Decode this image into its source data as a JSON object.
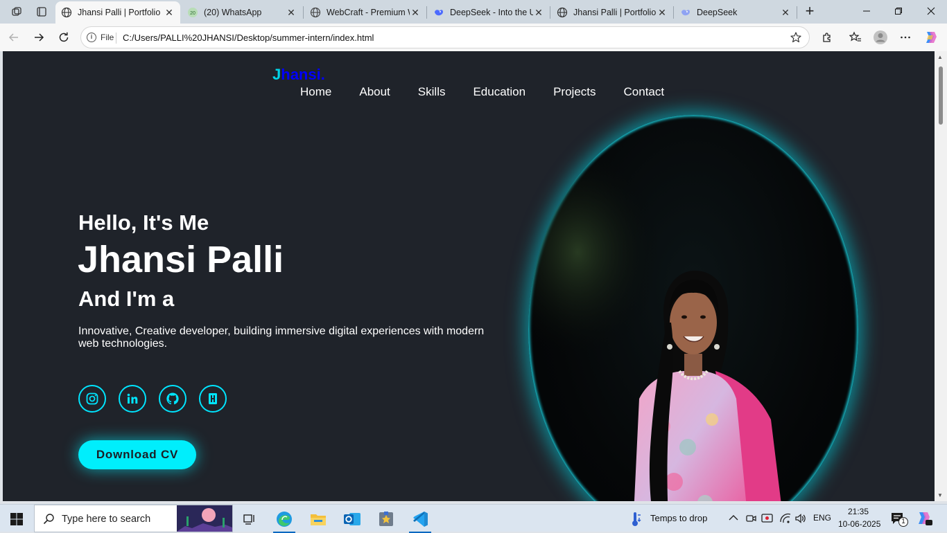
{
  "browser": {
    "tabs": [
      {
        "title": "Jhansi Palli | Portfolio",
        "icon": "globe-icon",
        "active": true
      },
      {
        "title": "(20) WhatsApp",
        "icon": "whatsapp-icon",
        "badge": "20",
        "active": false
      },
      {
        "title": "WebCraft - Premium W",
        "icon": "globe-icon",
        "active": false
      },
      {
        "title": "DeepSeek - Into the U",
        "icon": "deepseek-icon",
        "active": false
      },
      {
        "title": "Jhansi Palli | Portfolio",
        "icon": "globe-icon",
        "active": false
      },
      {
        "title": "DeepSeek",
        "icon": "deepseek-icon",
        "active": false
      }
    ],
    "address": {
      "scheme_label": "File",
      "url": "C:/Users/PALLI%20JHANSI/Desktop/summer-intern/index.html"
    }
  },
  "page": {
    "logo": {
      "first": "J",
      "rest": "hansi."
    },
    "nav": [
      "Home",
      "About",
      "Skills",
      "Education",
      "Projects",
      "Contact"
    ],
    "hero": {
      "greeting": "Hello, It's Me",
      "name": "Jhansi Palli",
      "role": "And I'm a",
      "description": "Innovative, Creative developer, building immersive digital experiences with modern web technologies."
    },
    "socials": [
      "instagram-icon",
      "linkedin-icon",
      "github-icon",
      "hackerrank-icon"
    ],
    "cta": "Download CV",
    "colors": {
      "accent": "#00eefc",
      "background": "#1f232a",
      "logo_blue": "#0000ff"
    }
  },
  "taskbar": {
    "search_placeholder": "Type here to search",
    "weather": "Temps to drop",
    "language": "ENG",
    "time": "21:35",
    "date": "10-06-2025",
    "notification_count": "1"
  }
}
